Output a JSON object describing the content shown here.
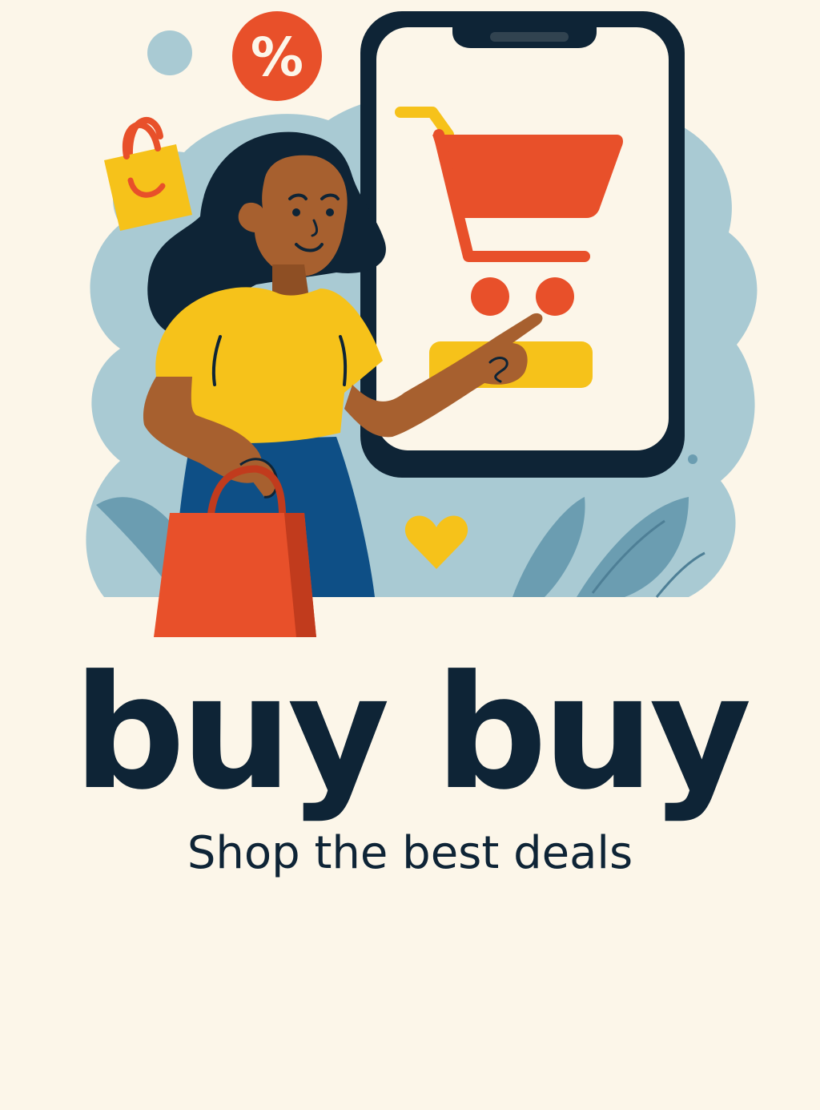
{
  "app": {
    "name": "buy buy",
    "tagline": "Shop the best deals"
  },
  "illustration": {
    "badge_symbol": "%",
    "icons": [
      "percent-badge-icon",
      "smiling-shopping-bag-icon",
      "shopping-cart-icon",
      "heart-icon",
      "handbag-icon",
      "smartphone-icon"
    ]
  },
  "colors": {
    "background": "#FCF6E9",
    "navy": "#0E2436",
    "orange": "#E8502A",
    "yellow": "#F6C21A",
    "light_blue": "#A9CAD3",
    "teal": "#6B9DB1",
    "skin": "#A7602F",
    "skirt_blue": "#0E4F86"
  }
}
